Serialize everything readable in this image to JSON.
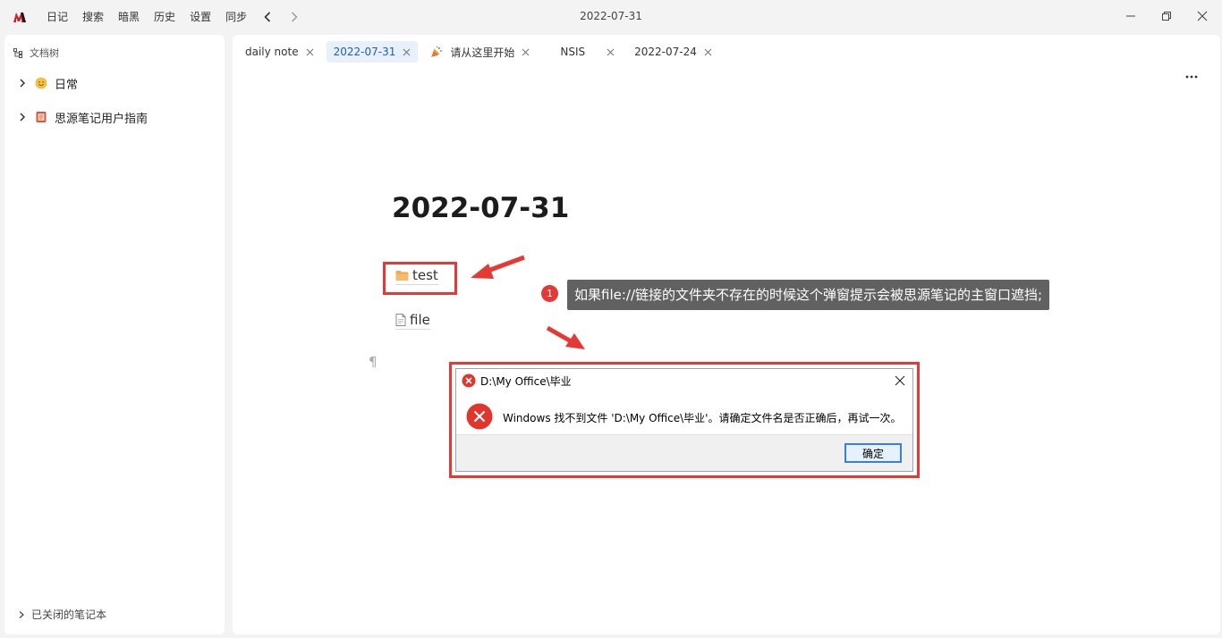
{
  "titlebar": {
    "menu": [
      "日记",
      "搜索",
      "暗黑",
      "历史",
      "设置",
      "同步"
    ],
    "window_title": "2022-07-31"
  },
  "sidebar": {
    "header": "文档树",
    "notebooks": [
      {
        "label": "日常",
        "icon": "smiley-emoji-icon"
      },
      {
        "label": "思源笔记用户指南",
        "icon": "book-emoji-icon"
      }
    ],
    "footer": "已关闭的笔记本"
  },
  "tabs": [
    {
      "label": "daily note",
      "active": false
    },
    {
      "label": "2022-07-31",
      "active": true
    },
    {
      "label": "请从这里开始",
      "active": false,
      "icon": "party-popper-icon"
    },
    {
      "label": "NSIS",
      "active": false
    },
    {
      "label": "2022-07-24",
      "active": false
    }
  ],
  "document": {
    "title": "2022-07-31",
    "links": [
      {
        "label": "test",
        "icon": "folder-icon"
      },
      {
        "label": "file",
        "icon": "file-icon"
      }
    ],
    "paragraph_mark": "¶"
  },
  "annotation": {
    "badge": "1",
    "callout": "如果file://链接的文件夹不存在的时候这个弹窗提示会被思源笔记的主窗口遮挡;",
    "color": "#e53935"
  },
  "dialog": {
    "title": "D:\\My Office\\毕业",
    "message": "Windows 找不到文件 'D:\\My Office\\毕业'。请确定文件名是否正确后，再试一次。",
    "ok_label": "确定"
  },
  "colors": {
    "accent": "#1f5fb8",
    "active_tab_bg": "#e8f0fb",
    "error_red": "#e53935"
  }
}
